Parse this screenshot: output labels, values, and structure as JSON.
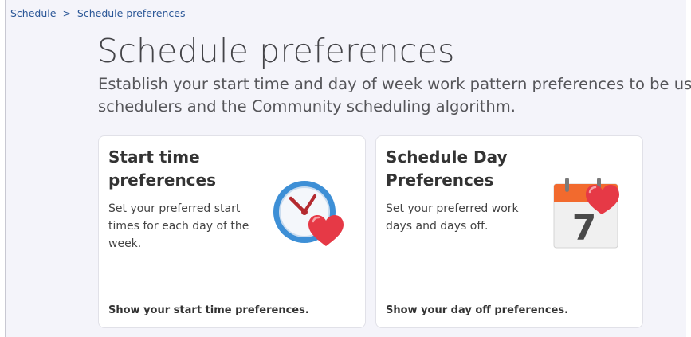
{
  "breadcrumb": {
    "root": "Schedule",
    "separator": ">",
    "current": "Schedule preferences"
  },
  "page": {
    "title": "Schedule preferences",
    "description_line1": "Establish your start time and day of week work pattern preferences to be used by y",
    "description_line2": "schedulers and the Community scheduling algorithm."
  },
  "cards": [
    {
      "title": "Start time preferences",
      "description": "Set your preferred start times for each day of the week.",
      "link": "Show your start time preferences.",
      "icon": "clock-heart-icon"
    },
    {
      "title": "Schedule Day Preferences",
      "description": "Set your preferred work days and days off.",
      "link": "Show your day off preferences.",
      "icon": "calendar-heart-icon",
      "calendar_day": "7"
    }
  ],
  "colors": {
    "breadcrumb_link": "#2b5797",
    "background": "#f4f4fa",
    "clock_blue": "#3d8fd6",
    "heart_red": "#e63946",
    "calendar_orange": "#f26a2e"
  }
}
